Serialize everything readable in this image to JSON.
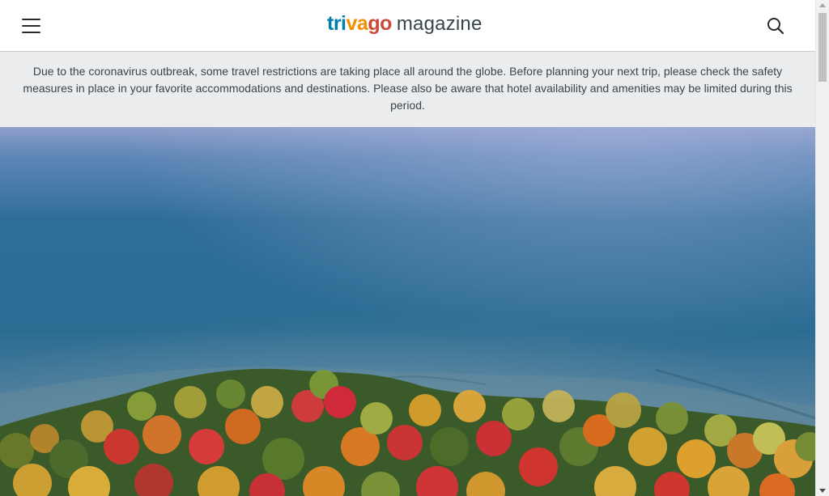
{
  "header": {
    "menu_icon": "hamburger-menu-icon",
    "logo": {
      "part_tri": "tri",
      "part_va": "va",
      "part_go": "go",
      "suffix": "magazine",
      "colors": {
        "tri": "#007faf",
        "va": "#f48f00",
        "go": "#c94a38",
        "suffix": "#37454d"
      }
    },
    "search_icon": "search-icon"
  },
  "notice": {
    "text": "Due to the coronavirus outbreak, some travel restrictions are taking place all around the globe. Before planning your next trip, please check the safety measures in place in your favorite accommodations and destinations. Please also be aware that hotel availability and amenities may be limited during this period."
  },
  "hero": {
    "image": "aerial-lake-autumn-forest",
    "colors": {
      "water_top": "#8fa1c9",
      "water_mid": "#2f6f97",
      "water_shallow": "#5f8aa3",
      "foliage_red": "#d8283a",
      "foliage_orange": "#e27a1c",
      "foliage_yellow": "#d7b33a",
      "foliage_green": "#3f5e2a"
    }
  },
  "scrollbar": {
    "position_fraction": 0.0
  }
}
